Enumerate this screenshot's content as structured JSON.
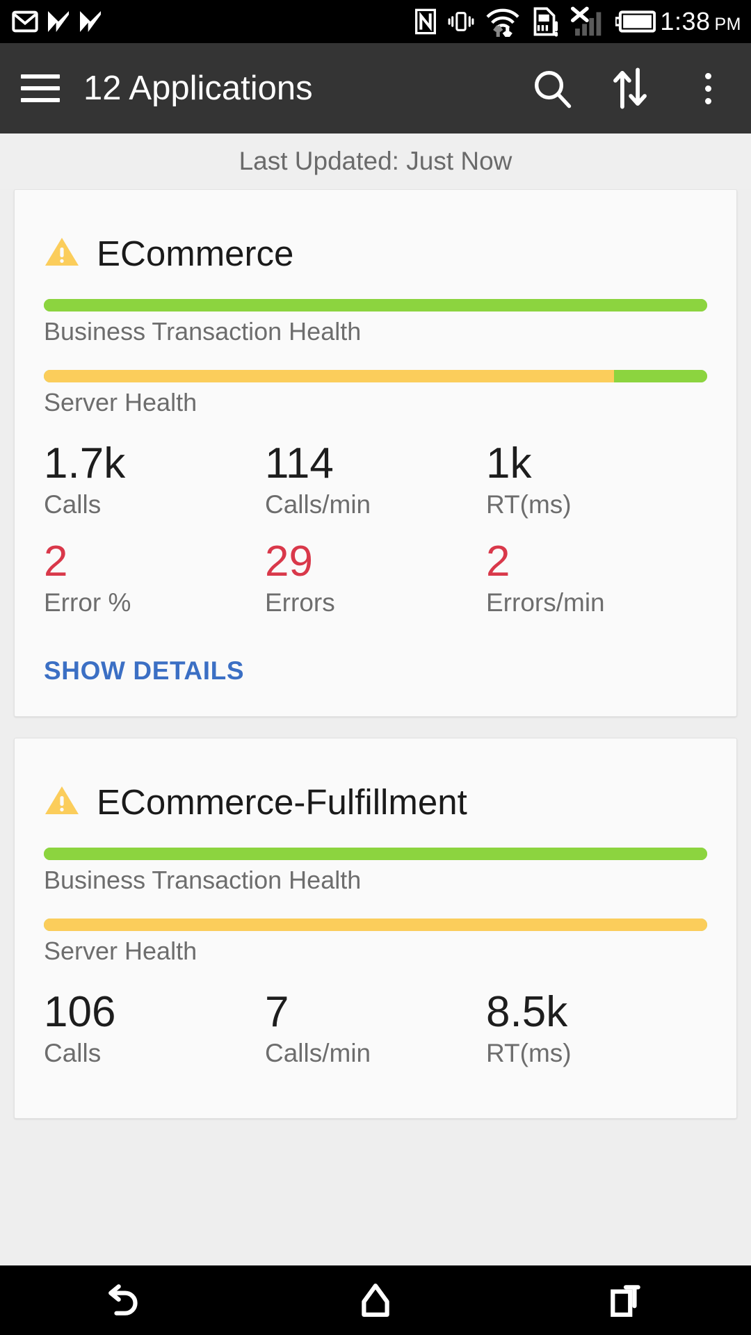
{
  "statusbar": {
    "time": "1:38",
    "ampm": "PM",
    "icons": [
      "gmail-icon",
      "app-logo-icon",
      "app-logo-icon-2",
      "nfc-icon",
      "vibrate-icon",
      "wifi-data-icon",
      "sim-card-alert-icon",
      "no-signal-icon",
      "battery-icon"
    ]
  },
  "appbar": {
    "menu_icon": "hamburger-menu-icon",
    "title": "12 Applications",
    "search_icon": "search-icon",
    "sort_icon": "sort-arrows-icon",
    "overflow_icon": "more-vertical-icon"
  },
  "status_line": {
    "text": "Last Updated: Just Now"
  },
  "colors": {
    "health_green": "#8cd43f",
    "health_amber": "#fbcd5b",
    "error_red": "#d9384a",
    "link_blue": "#3b6fc4",
    "warning_yellow": "#fbcd5b",
    "appbar_bg": "#343434",
    "page_bg": "#eeeeee",
    "card_bg": "#fafafa"
  },
  "cards": [
    {
      "status_icon": "warning-triangle-icon",
      "title": "ECommerce",
      "bars": [
        {
          "label": "Business Transaction Health",
          "segments": [
            {
              "color": "#8cd43f",
              "percent": 100
            }
          ]
        },
        {
          "label": "Server Health",
          "segments": [
            {
              "color": "#fbcd5b",
              "percent": 86
            },
            {
              "color": "#8cd43f",
              "percent": 14
            }
          ]
        }
      ],
      "metrics_row1": [
        {
          "value": "1.7k",
          "label": "Calls",
          "error": false
        },
        {
          "value": "114",
          "label": "Calls/min",
          "error": false
        },
        {
          "value": "1k",
          "label": "RT(ms)",
          "error": false
        }
      ],
      "metrics_row2": [
        {
          "value": "2",
          "label": "Error %",
          "error": true
        },
        {
          "value": "29",
          "label": "Errors",
          "error": true
        },
        {
          "value": "2",
          "label": "Errors/min",
          "error": true
        }
      ],
      "action_label": "SHOW DETAILS"
    },
    {
      "status_icon": "warning-triangle-icon",
      "title": "ECommerce-Fulfillment",
      "bars": [
        {
          "label": "Business Transaction Health",
          "segments": [
            {
              "color": "#8cd43f",
              "percent": 100
            }
          ]
        },
        {
          "label": "Server Health",
          "segments": [
            {
              "color": "#fbcd5b",
              "percent": 100
            }
          ]
        }
      ],
      "metrics_row1": [
        {
          "value": "106",
          "label": "Calls",
          "error": false
        },
        {
          "value": "7",
          "label": "Calls/min",
          "error": false
        },
        {
          "value": "8.5k",
          "label": "RT(ms)",
          "error": false
        }
      ],
      "metrics_row2": [],
      "action_label": ""
    }
  ],
  "navbar": {
    "back_icon": "back-arrow-icon",
    "home_icon": "home-icon",
    "recents_icon": "recent-apps-icon"
  }
}
